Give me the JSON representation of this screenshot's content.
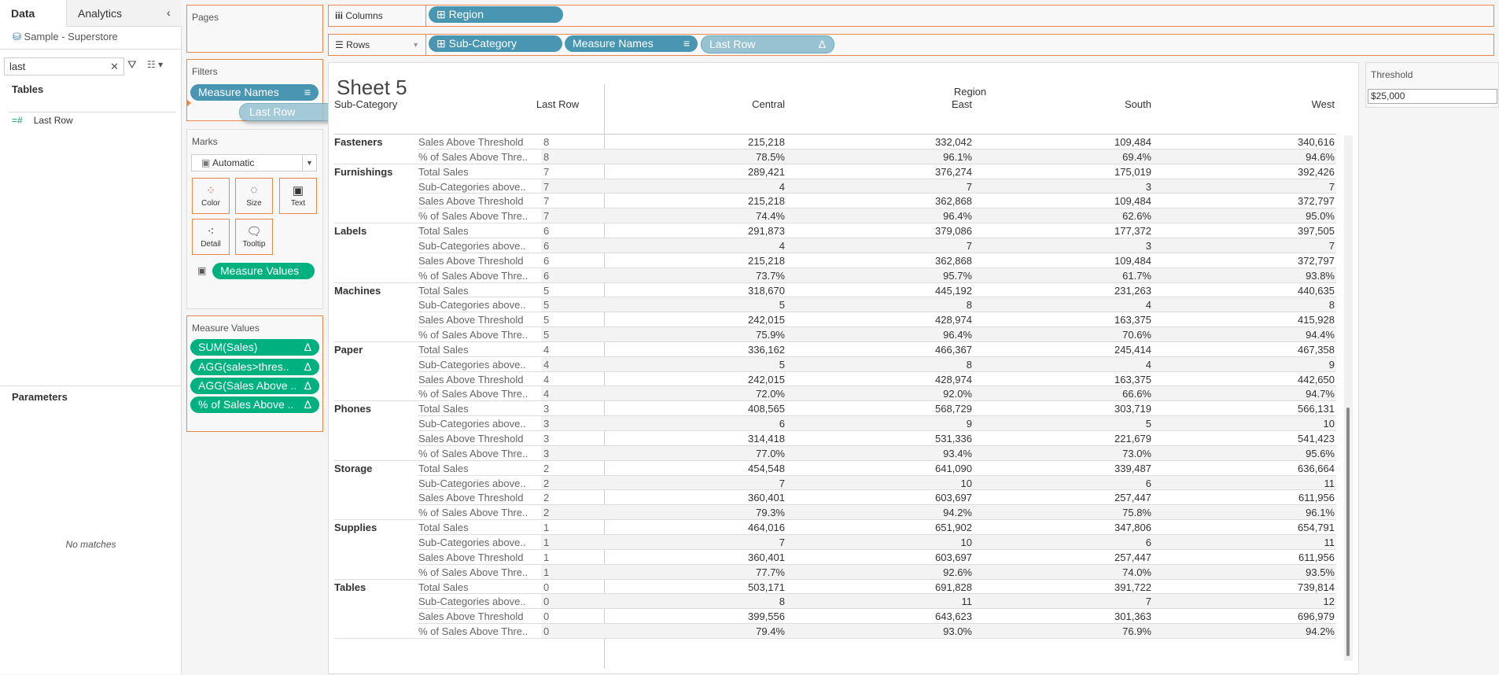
{
  "left_panel": {
    "tabs": [
      "Data",
      "Analytics"
    ],
    "datasource": "Sample - Superstore",
    "search_value": "last",
    "tables_heading": "Tables",
    "fields": [
      "Last Row"
    ],
    "parameters_heading": "Parameters",
    "no_matches": "No matches"
  },
  "pages": {
    "title": "Pages"
  },
  "filters": {
    "title": "Filters",
    "pills": [
      "Measure Names"
    ],
    "dragging_pill": "Last Row"
  },
  "marks": {
    "title": "Marks",
    "type": "Automatic",
    "buttons": [
      "Color",
      "Size",
      "Text",
      "Detail",
      "Tooltip"
    ],
    "text_pill": "Measure Values"
  },
  "measure_values": {
    "title": "Measure Values",
    "pills": [
      "SUM(Sales)",
      "AGG(sales>thres..",
      "AGG(Sales Above ..",
      "% of Sales Above .."
    ],
    "delta_icon": "Δ"
  },
  "columns_shelf": {
    "label": "Columns",
    "pills": [
      "Region"
    ]
  },
  "rows_shelf": {
    "label": "Rows",
    "pills": [
      "Sub-Category",
      "Measure Names",
      "Last Row"
    ]
  },
  "sheet": {
    "title": "Sheet 5",
    "region_header": "Region",
    "row_headers": [
      "Sub-Category",
      "Last Row"
    ],
    "columns": [
      "Central",
      "East",
      "South",
      "West"
    ],
    "groups": [
      {
        "name": "Fasteners",
        "rows": [
          {
            "m": "Sales Above Threshold",
            "lr": "8",
            "v": [
              "215,218",
              "332,042",
              "109,484",
              "340,616"
            ]
          },
          {
            "m": "% of Sales Above Thre..",
            "lr": "8",
            "v": [
              "78.5%",
              "96.1%",
              "69.4%",
              "94.6%"
            ]
          }
        ]
      },
      {
        "name": "Furnishings",
        "rows": [
          {
            "m": "Total Sales",
            "lr": "7",
            "v": [
              "289,421",
              "376,274",
              "175,019",
              "392,426"
            ]
          },
          {
            "m": "Sub-Categories above..",
            "lr": "7",
            "v": [
              "4",
              "7",
              "3",
              "7"
            ]
          },
          {
            "m": "Sales Above Threshold",
            "lr": "7",
            "v": [
              "215,218",
              "362,868",
              "109,484",
              "372,797"
            ]
          },
          {
            "m": "% of Sales Above Thre..",
            "lr": "7",
            "v": [
              "74.4%",
              "96.4%",
              "62.6%",
              "95.0%"
            ]
          }
        ]
      },
      {
        "name": "Labels",
        "rows": [
          {
            "m": "Total Sales",
            "lr": "6",
            "v": [
              "291,873",
              "379,086",
              "177,372",
              "397,505"
            ]
          },
          {
            "m": "Sub-Categories above..",
            "lr": "6",
            "v": [
              "4",
              "7",
              "3",
              "7"
            ]
          },
          {
            "m": "Sales Above Threshold",
            "lr": "6",
            "v": [
              "215,218",
              "362,868",
              "109,484",
              "372,797"
            ]
          },
          {
            "m": "% of Sales Above Thre..",
            "lr": "6",
            "v": [
              "73.7%",
              "95.7%",
              "61.7%",
              "93.8%"
            ]
          }
        ]
      },
      {
        "name": "Machines",
        "rows": [
          {
            "m": "Total Sales",
            "lr": "5",
            "v": [
              "318,670",
              "445,192",
              "231,263",
              "440,635"
            ]
          },
          {
            "m": "Sub-Categories above..",
            "lr": "5",
            "v": [
              "5",
              "8",
              "4",
              "8"
            ]
          },
          {
            "m": "Sales Above Threshold",
            "lr": "5",
            "v": [
              "242,015",
              "428,974",
              "163,375",
              "415,928"
            ]
          },
          {
            "m": "% of Sales Above Thre..",
            "lr": "5",
            "v": [
              "75.9%",
              "96.4%",
              "70.6%",
              "94.4%"
            ]
          }
        ]
      },
      {
        "name": "Paper",
        "rows": [
          {
            "m": "Total Sales",
            "lr": "4",
            "v": [
              "336,162",
              "466,367",
              "245,414",
              "467,358"
            ]
          },
          {
            "m": "Sub-Categories above..",
            "lr": "4",
            "v": [
              "5",
              "8",
              "4",
              "9"
            ]
          },
          {
            "m": "Sales Above Threshold",
            "lr": "4",
            "v": [
              "242,015",
              "428,974",
              "163,375",
              "442,650"
            ]
          },
          {
            "m": "% of Sales Above Thre..",
            "lr": "4",
            "v": [
              "72.0%",
              "92.0%",
              "66.6%",
              "94.7%"
            ]
          }
        ]
      },
      {
        "name": "Phones",
        "rows": [
          {
            "m": "Total Sales",
            "lr": "3",
            "v": [
              "408,565",
              "568,729",
              "303,719",
              "566,131"
            ]
          },
          {
            "m": "Sub-Categories above..",
            "lr": "3",
            "v": [
              "6",
              "9",
              "5",
              "10"
            ]
          },
          {
            "m": "Sales Above Threshold",
            "lr": "3",
            "v": [
              "314,418",
              "531,336",
              "221,679",
              "541,423"
            ]
          },
          {
            "m": "% of Sales Above Thre..",
            "lr": "3",
            "v": [
              "77.0%",
              "93.4%",
              "73.0%",
              "95.6%"
            ]
          }
        ]
      },
      {
        "name": "Storage",
        "rows": [
          {
            "m": "Total Sales",
            "lr": "2",
            "v": [
              "454,548",
              "641,090",
              "339,487",
              "636,664"
            ]
          },
          {
            "m": "Sub-Categories above..",
            "lr": "2",
            "v": [
              "7",
              "10",
              "6",
              "11"
            ]
          },
          {
            "m": "Sales Above Threshold",
            "lr": "2",
            "v": [
              "360,401",
              "603,697",
              "257,447",
              "611,956"
            ]
          },
          {
            "m": "% of Sales Above Thre..",
            "lr": "2",
            "v": [
              "79.3%",
              "94.2%",
              "75.8%",
              "96.1%"
            ]
          }
        ]
      },
      {
        "name": "Supplies",
        "rows": [
          {
            "m": "Total Sales",
            "lr": "1",
            "v": [
              "464,016",
              "651,902",
              "347,806",
              "654,791"
            ]
          },
          {
            "m": "Sub-Categories above..",
            "lr": "1",
            "v": [
              "7",
              "10",
              "6",
              "11"
            ]
          },
          {
            "m": "Sales Above Threshold",
            "lr": "1",
            "v": [
              "360,401",
              "603,697",
              "257,447",
              "611,956"
            ]
          },
          {
            "m": "% of Sales Above Thre..",
            "lr": "1",
            "v": [
              "77.7%",
              "92.6%",
              "74.0%",
              "93.5%"
            ]
          }
        ]
      },
      {
        "name": "Tables",
        "rows": [
          {
            "m": "Total Sales",
            "lr": "0",
            "v": [
              "503,171",
              "691,828",
              "391,722",
              "739,814"
            ]
          },
          {
            "m": "Sub-Categories above..",
            "lr": "0",
            "v": [
              "8",
              "11",
              "7",
              "12"
            ]
          },
          {
            "m": "Sales Above Threshold",
            "lr": "0",
            "v": [
              "399,556",
              "643,623",
              "301,363",
              "696,979"
            ]
          },
          {
            "m": "% of Sales Above Thre..",
            "lr": "0",
            "v": [
              "79.4%",
              "93.0%",
              "76.9%",
              "94.2%"
            ]
          }
        ]
      }
    ]
  },
  "threshold": {
    "title": "Threshold",
    "value": "$25,000"
  },
  "colors": {
    "accent": "#e8884a",
    "pill_dim": "#4996b2",
    "pill_measure": "#00b180"
  }
}
